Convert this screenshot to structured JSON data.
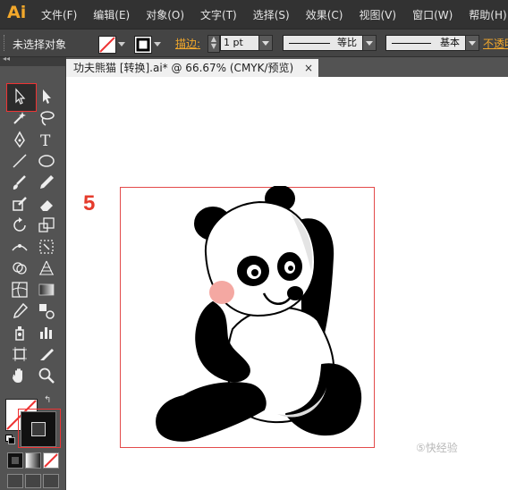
{
  "app": {
    "logo": "Ai"
  },
  "menu": [
    "文件(F)",
    "编辑(E)",
    "对象(O)",
    "文字(T)",
    "选择(S)",
    "效果(C)",
    "视图(V)",
    "窗口(W)",
    "帮助(H)"
  ],
  "control_bar": {
    "selection_label": "未选择对象",
    "stroke_label": "描边:",
    "stroke_weight": "1 pt",
    "profile_label": "等比",
    "brush_label": "基本",
    "opacity_label": "不透明"
  },
  "document": {
    "tab_title": "功夫熊猫 [转换].ai* @ 66.67% (CMYK/预览)",
    "close_glyph": "×"
  },
  "annotation": "5",
  "watermark": "⑤快经验",
  "colors": {
    "accent": "#f2a82b",
    "highlight": "#e33333",
    "panel": "#535353",
    "menubar": "#323232"
  }
}
